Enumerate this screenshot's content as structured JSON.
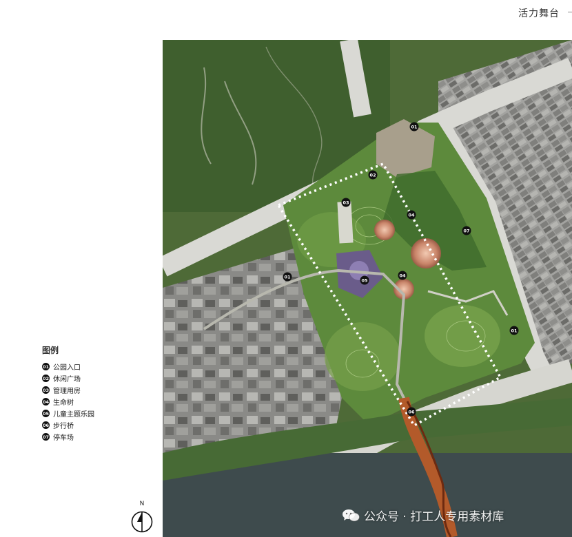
{
  "header": {
    "title": "活力舞台"
  },
  "legend": {
    "title": "图例",
    "items": [
      {
        "num": "01",
        "label": "公园入口"
      },
      {
        "num": "02",
        "label": "休闲广场"
      },
      {
        "num": "03",
        "label": "管理用房"
      },
      {
        "num": "04",
        "label": "生命树"
      },
      {
        "num": "05",
        "label": "儿童主题乐园"
      },
      {
        "num": "06",
        "label": "步行桥"
      },
      {
        "num": "07",
        "label": "停车场"
      }
    ]
  },
  "north_arrow": {
    "label": "N",
    "icon": "north-arrow-icon"
  },
  "map": {
    "markers": [
      {
        "num": "01",
        "label": "公园入口"
      },
      {
        "num": "01",
        "label": "公园入口"
      },
      {
        "num": "01",
        "label": "公园入口"
      },
      {
        "num": "02",
        "label": "休闲广场"
      },
      {
        "num": "03",
        "label": "管理用房"
      },
      {
        "num": "04",
        "label": "生命树"
      },
      {
        "num": "04",
        "label": "生命树"
      },
      {
        "num": "05",
        "label": "儿童主题乐园"
      },
      {
        "num": "06",
        "label": "步行桥"
      },
      {
        "num": "07",
        "label": "停车场"
      }
    ]
  },
  "watermark": {
    "text": "公众号 · 打工人专用素材库",
    "icon": "wechat-icon"
  }
}
